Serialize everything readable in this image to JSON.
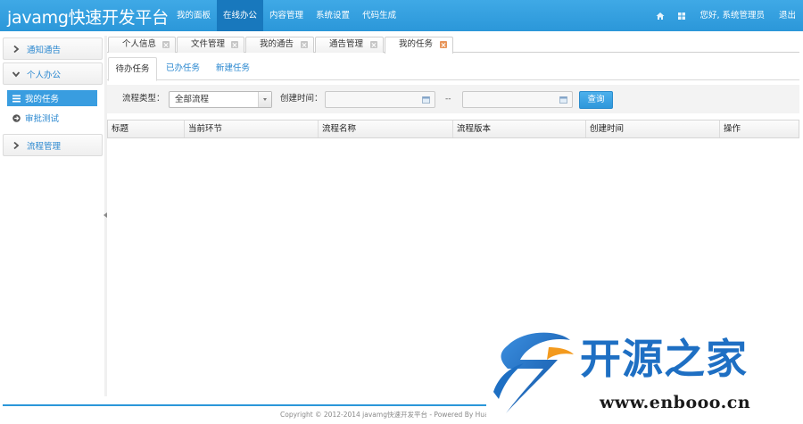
{
  "header": {
    "brand": "javamg快速开发平台",
    "nav": [
      {
        "label": "我的面板"
      },
      {
        "label": "在线办公",
        "active": true
      },
      {
        "label": "内容管理"
      },
      {
        "label": "系统设置"
      },
      {
        "label": "代码生成"
      }
    ],
    "greeting": "您好, 系统管理员",
    "logout": "退出",
    "icons": [
      "home-icon",
      "grid-icon"
    ]
  },
  "sidebar": {
    "groups": [
      {
        "label": "通知通告",
        "expanded": false
      },
      {
        "label": "个人办公",
        "expanded": true,
        "items": [
          {
            "label": "我的任务",
            "icon": "list-icon",
            "active": true
          },
          {
            "label": "审批测试",
            "icon": "circle-arrow-icon"
          }
        ]
      },
      {
        "label": "流程管理",
        "expanded": false
      }
    ]
  },
  "tabs": [
    {
      "label": "个人信息"
    },
    {
      "label": "文件管理"
    },
    {
      "label": "我的通告"
    },
    {
      "label": "通告管理"
    },
    {
      "label": "我的任务",
      "active": true
    }
  ],
  "subtabs": [
    {
      "label": "待办任务",
      "active": true
    },
    {
      "label": "已办任务"
    },
    {
      "label": "新建任务"
    }
  ],
  "filter": {
    "type_label": "流程类型：",
    "type_value": "全部流程",
    "created_label": "创建时间：",
    "range_separator": "--",
    "query_button": "查询"
  },
  "table": {
    "columns": [
      "标题",
      "当前环节",
      "流程名称",
      "流程版本",
      "创建时间",
      "操作"
    ]
  },
  "footer": {
    "copyright": "Copyright © 2012-2014 javamg快速开发平台 - Powered By HuaYing"
  },
  "watermark": {
    "title": "开源之家",
    "url": "www.enbooo.cn"
  },
  "colors": {
    "header": "#2b97d9",
    "nav_active": "#1878bd",
    "link": "#2b88d0",
    "sidebar_active": "#399de0",
    "tab_close_active": "#e8955a",
    "watermark_blue": "#1e6fc3"
  }
}
